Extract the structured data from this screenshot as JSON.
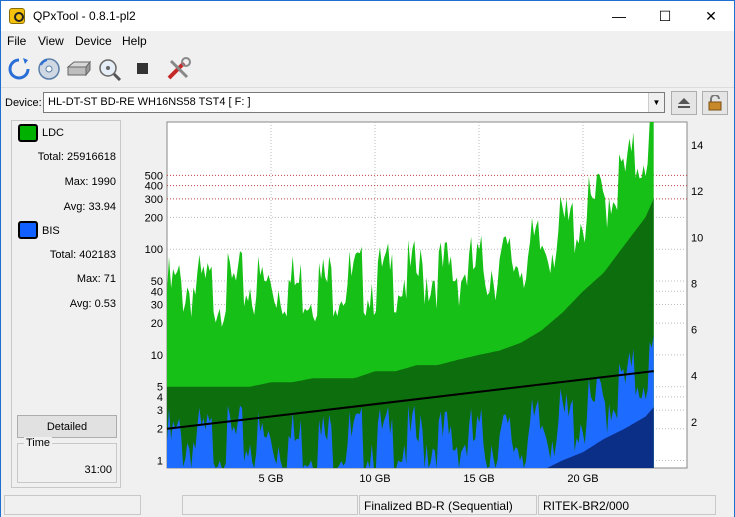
{
  "window": {
    "title": "QPxTool - 0.8.1-pl2",
    "minimize": "—",
    "maximize": "☐",
    "close": "✕"
  },
  "menu": [
    "File",
    "View",
    "Device",
    "Help"
  ],
  "toolbar": {
    "icons": [
      "refresh-icon",
      "disc-icon",
      "drive-icon",
      "scan-icon",
      "stop-icon",
      "tools-icon"
    ]
  },
  "device": {
    "label": "Device:",
    "value": "HL-DT-ST BD-RE  WH16NS58  TST4 [ F: ]"
  },
  "ldc": {
    "name": "LDC",
    "color": "#00b000",
    "total_label": "Total:",
    "total": "25916618",
    "max_label": "Max:",
    "max": "1990",
    "avg_label": "Avg:",
    "avg": "33.94"
  },
  "bis": {
    "name": "BIS",
    "color": "#1060ff",
    "total_label": "Total:",
    "total": "402183",
    "max_label": "Max:",
    "max": "71",
    "avg_label": "Avg:",
    "avg": "0.53"
  },
  "detailed_label": "Detailed",
  "time": {
    "title": "Time",
    "value": "31:00"
  },
  "chart_data": {
    "type": "area",
    "x_ticks": [
      "5 GB",
      "10 GB",
      "15 GB",
      "20 GB"
    ],
    "x_tick_values": [
      5,
      10,
      15,
      20
    ],
    "xlim": [
      0,
      25
    ],
    "y_left_ticks": [
      "1",
      "2",
      "3",
      "4",
      "5",
      "10",
      "20",
      "30",
      "40",
      "50",
      "100",
      "200",
      "300",
      "400",
      "500"
    ],
    "y_left_values": [
      1,
      2,
      3,
      4,
      5,
      10,
      20,
      30,
      40,
      50,
      100,
      200,
      300,
      400,
      500
    ],
    "y_left_scale": "log",
    "ylim_left": [
      0.85,
      1600
    ],
    "y_right_ticks": [
      "2",
      "4",
      "6",
      "8",
      "10",
      "12",
      "14"
    ],
    "y_right_values": [
      2,
      4,
      6,
      8,
      10,
      12,
      14
    ],
    "ylim_right": [
      0,
      15
    ],
    "grid": true,
    "series": [
      {
        "name": "LDC",
        "color": "#00c000",
        "x": [
          0,
          1,
          2,
          3,
          4,
          5,
          6,
          7,
          8,
          9,
          10,
          11,
          12,
          13,
          14,
          15,
          16,
          17,
          18,
          19,
          20,
          21,
          22,
          23,
          23.4
        ],
        "max": [
          40,
          45,
          40,
          42,
          45,
          45,
          45,
          45,
          48,
          50,
          50,
          55,
          55,
          60,
          60,
          65,
          70,
          80,
          100,
          150,
          200,
          300,
          500,
          900,
          1500
        ],
        "avg": [
          5,
          5,
          5,
          5,
          5,
          5.5,
          5.5,
          6,
          6,
          6,
          7,
          7,
          8,
          8,
          9,
          10,
          11,
          13,
          17,
          25,
          40,
          60,
          110,
          200,
          300
        ]
      },
      {
        "name": "BIS",
        "color": "#1e6bff",
        "x": [
          0,
          1,
          2,
          3,
          4,
          5,
          6,
          7,
          8,
          9,
          10,
          11,
          12,
          13,
          14,
          15,
          16,
          17,
          18,
          19,
          20,
          21,
          22,
          23,
          23.4
        ],
        "max": [
          1.5,
          1.5,
          1.5,
          1.5,
          1.5,
          1.5,
          1.5,
          1.5,
          1.5,
          1.5,
          1.5,
          1.5,
          1.5,
          1.5,
          1.5,
          1.5,
          1.5,
          1.5,
          2,
          2.2,
          2.5,
          3.5,
          5,
          7,
          9
        ],
        "avg": [
          0.5,
          0.5,
          0.5,
          0.5,
          0.5,
          0.5,
          0.5,
          0.5,
          0.5,
          0.5,
          0.5,
          0.5,
          0.5,
          0.5,
          0.5,
          0.5,
          0.5,
          0.5,
          0.8,
          1,
          1.2,
          1.6,
          2,
          2.6,
          3.2
        ]
      },
      {
        "name": "Speed",
        "color": "#000000",
        "x": [
          0,
          23.4
        ],
        "y_right": [
          1.7,
          4.2
        ]
      }
    ]
  },
  "statusbar": [
    "",
    "",
    "Finalized BD-R (Sequential)",
    "RITEK-BR2/000"
  ]
}
